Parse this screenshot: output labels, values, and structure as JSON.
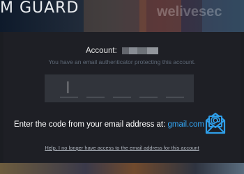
{
  "header": {
    "title": "M GUARD",
    "watermark": "welivesec"
  },
  "dialog": {
    "account_label": "Account:",
    "account_note": "You have an email authenticator protecting this account.",
    "code_slots": 5,
    "enter_code_prefix": "Enter the code from your email address at: ",
    "email_domain": "gmail.com",
    "help_link": "Help, I no longer have access to the email address for this account"
  },
  "icons": {
    "email": "email-envelope-icon"
  },
  "colors": {
    "accent": "#33a6f4",
    "dialog_bg": "#1e1f25",
    "code_box_bg": "#31343b"
  }
}
